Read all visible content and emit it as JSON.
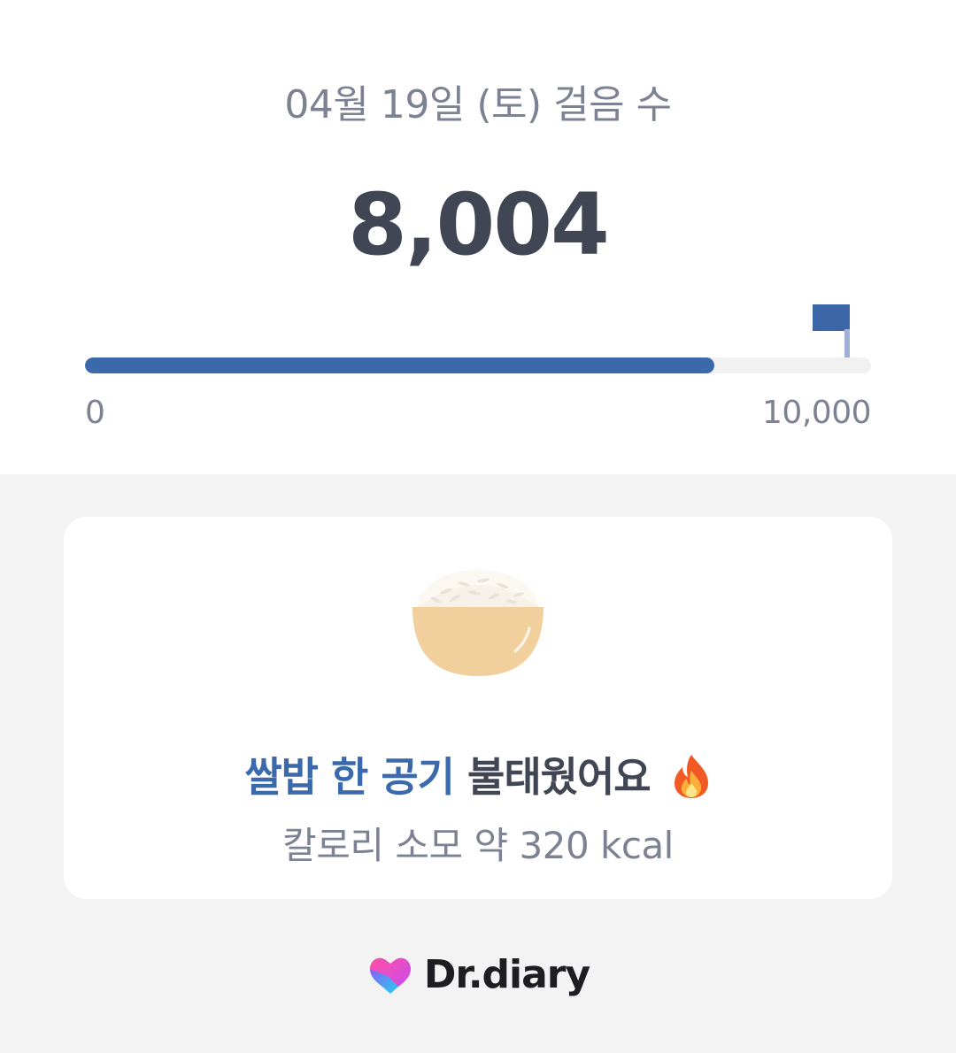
{
  "header": {
    "date_title": "04월 19일 (토) 걸음 수"
  },
  "steps": {
    "count": "8,004",
    "progress_fraction": 0.8004,
    "scale_min": "0",
    "scale_max": "10,000"
  },
  "card": {
    "headline_highlight": "쌀밥 한 공기",
    "headline_rest": "불태웠어요",
    "subline": "칼로리 소모 약 320 kcal",
    "image_icon": "rice-bowl-icon",
    "emoji_icon": "fire-icon"
  },
  "brand": {
    "name": "Dr.diary",
    "logo_icon": "heart-logo-icon"
  },
  "colors": {
    "accent": "#3b6aac",
    "text_dark": "#404653",
    "text_muted": "#7c8293",
    "background": "#f3f3f4",
    "card": "#ffffff"
  }
}
